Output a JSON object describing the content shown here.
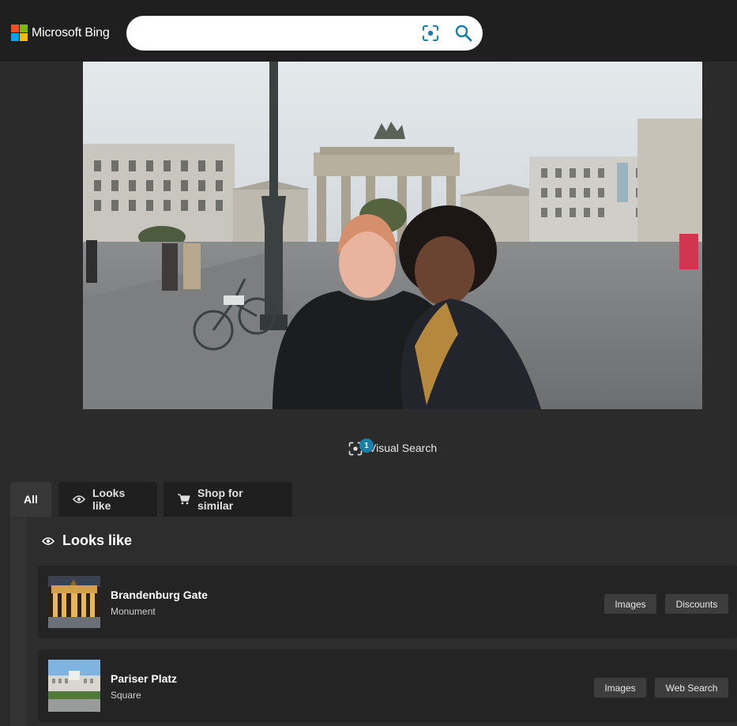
{
  "header": {
    "brand": "Microsoft Bing",
    "search": {
      "value": "",
      "placeholder": ""
    },
    "brand_colors": [
      "#f25022",
      "#7fba00",
      "#00a4ef",
      "#ffb900"
    ]
  },
  "photo": {
    "icon": "photo-icon"
  },
  "visual_search": {
    "label": "Visual Search",
    "badge_count": "1"
  },
  "tabs": [
    {
      "label": "All",
      "icon": ""
    },
    {
      "label": "Looks like",
      "icon": "eye-icon"
    },
    {
      "label": "Shop for similar",
      "icon": "cart-icon"
    }
  ],
  "section": {
    "title": "Looks like",
    "icon": "eye-icon"
  },
  "results": [
    {
      "name": "Brandenburg Gate",
      "type": "Monument",
      "actions": [
        "Images",
        "Discounts"
      ]
    },
    {
      "name": "Pariser Platz",
      "type": "Square",
      "actions": [
        "Images",
        "Web Search"
      ]
    }
  ],
  "colors": {
    "accent": "#1a7fa8",
    "background": "#2b2b2b",
    "header": "#1f1f1f"
  }
}
